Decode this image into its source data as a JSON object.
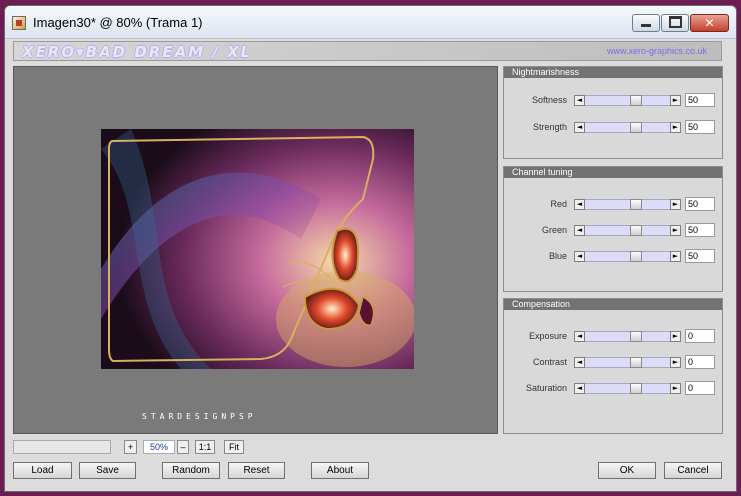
{
  "window": {
    "title": "Imagen30* @  80% (Trama 1)",
    "minimize_label": "",
    "close_label": "✕"
  },
  "banner": {
    "logo_text": "XERO▾BAD DREAM / XL",
    "url": "www.xero-graphics.co.uk"
  },
  "preview": {
    "signature": "STARDESIGNPSP"
  },
  "panels": [
    {
      "title": "Nightmarishness",
      "controls": [
        {
          "label": "Softness",
          "value": "50",
          "position": 0.5
        },
        {
          "label": "Strength",
          "value": "50",
          "position": 0.5
        }
      ]
    },
    {
      "title": "Channel tuning",
      "controls": [
        {
          "label": "Red",
          "value": "50",
          "position": 0.5
        },
        {
          "label": "Green",
          "value": "50",
          "position": 0.5
        },
        {
          "label": "Blue",
          "value": "50",
          "position": 0.5
        }
      ]
    },
    {
      "title": "Compensation",
      "controls": [
        {
          "label": "Exposure",
          "value": "0",
          "position": 0.5
        },
        {
          "label": "Contrast",
          "value": "0",
          "position": 0.5
        },
        {
          "label": "Saturation",
          "value": "0",
          "position": 0.5
        }
      ]
    }
  ],
  "zoom": {
    "plus": "+",
    "value": "50%",
    "minus": "–",
    "one_to_one": "1:1",
    "fit": "Fit"
  },
  "buttons": {
    "load": "Load",
    "save": "Save",
    "random": "Random",
    "reset": "Reset",
    "about": "About",
    "ok": "OK",
    "cancel": "Cancel"
  },
  "arrows": {
    "left": "◄",
    "right": "►"
  },
  "colors": {
    "panel_header": "#727272",
    "track": "#dcdcf7",
    "background": "#6b1e52",
    "zoom_text": "#1a3a9a"
  }
}
